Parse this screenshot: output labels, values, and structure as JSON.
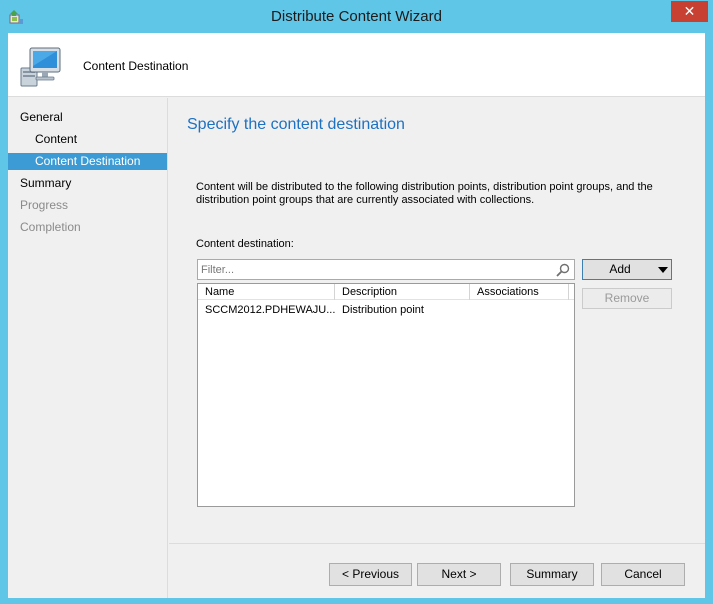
{
  "window": {
    "title": "Distribute Content Wizard",
    "close_glyph": "✕"
  },
  "header": {
    "title": "Content Destination",
    "icon": "computer-icon"
  },
  "sidebar": {
    "items": [
      {
        "label": "General",
        "level": 1,
        "state": "normal"
      },
      {
        "label": "Content",
        "level": 2,
        "state": "normal"
      },
      {
        "label": "Content Destination",
        "level": 2,
        "state": "active"
      },
      {
        "label": "Summary",
        "level": 1,
        "state": "normal"
      },
      {
        "label": "Progress",
        "level": 1,
        "state": "disabled"
      },
      {
        "label": "Completion",
        "level": 1,
        "state": "disabled"
      }
    ]
  },
  "main": {
    "heading": "Specify the content destination",
    "description": "Content will be distributed to the following distribution points, distribution point groups, and the distribution point groups that are currently associated with collections.",
    "destination_label": "Content destination:",
    "filter_placeholder": "Filter...",
    "add_label": "Add",
    "remove_label": "Remove",
    "columns": [
      "Name",
      "Description",
      "Associations"
    ],
    "rows": [
      {
        "name": "SCCM2012.PDHEWAJU...",
        "description": "Distribution point",
        "associations": ""
      }
    ]
  },
  "footer": {
    "previous_label": "< Previous",
    "next_label": "Next >",
    "summary_label": "Summary",
    "cancel_label": "Cancel"
  },
  "colors": {
    "title_bar": "#5fc6e8",
    "close_button": "#c84031",
    "active_nav": "#3c9bd4",
    "heading": "#1e71c0"
  }
}
